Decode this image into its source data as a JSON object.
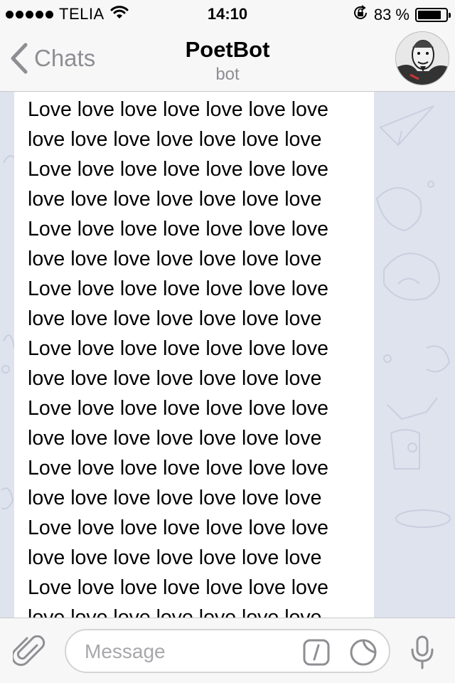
{
  "status_bar": {
    "carrier": "TELIA",
    "time": "14:10",
    "battery_percent": "83 %",
    "battery_level": 0.83
  },
  "nav": {
    "back_label": "Chats",
    "title": "PoetBot",
    "subtitle": "bot"
  },
  "message": {
    "lines": [
      "Love love love love love love love",
      "love love love love love love love",
      "Love love love love love love love",
      "love love love love love love love",
      "Love love love love love love love",
      "love love love love love love love",
      "Love love love love love love love",
      "love love love love love love love",
      "Love love love love love love love",
      "love love love love love love love",
      "Love love love love love love love",
      "love love love love love love love",
      "Love love love love love love love",
      "love love love love love love love",
      "Love love love love love love love",
      "love love love love love love love",
      "Love love love love love love love",
      "love love love love love love love"
    ]
  },
  "input": {
    "placeholder": "Message",
    "value": ""
  },
  "icons": {
    "signal": "signal-dots-icon",
    "wifi": "wifi-icon",
    "orientation_lock": "orientation-lock-icon",
    "battery": "battery-icon",
    "back": "chevron-left-icon",
    "avatar": "bot-avatar",
    "scroll_down": "chevron-down-icon",
    "attach": "paperclip-icon",
    "commands": "slash-command-icon",
    "sticker": "sticker-icon",
    "mic": "microphone-icon"
  },
  "colors": {
    "chat_background": "#dfe3ee",
    "bar_background": "#f7f7f7",
    "muted_text": "#8e8e93"
  }
}
